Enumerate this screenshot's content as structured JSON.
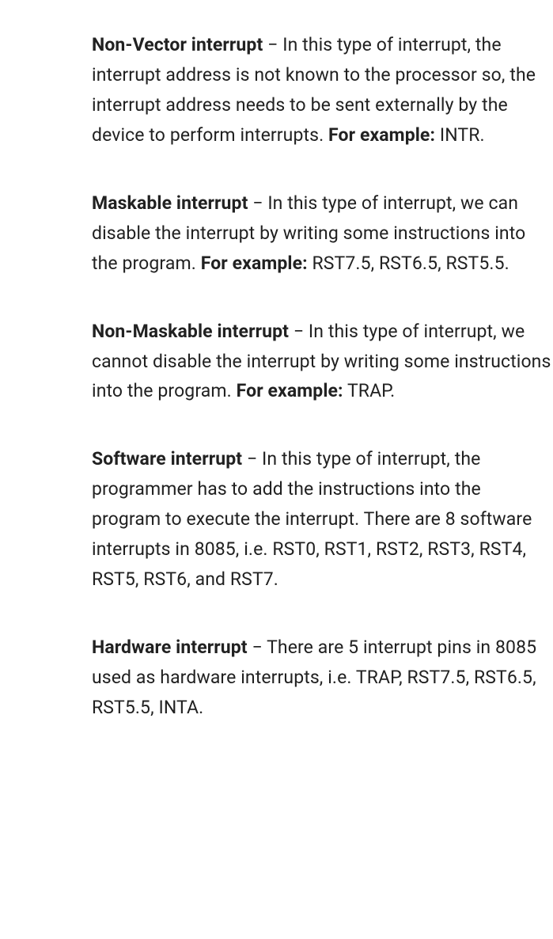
{
  "entries": [
    {
      "term": "Non-Vector interrupt",
      "dash": " − ",
      "description": "In this type of interrupt, the interrupt address is not known to the processor so, the interrupt address needs to be sent externally by the device to perform interrupts. ",
      "example_label": "For example:",
      "example_text": " INTR."
    },
    {
      "term": "Maskable interrupt",
      "dash": " − ",
      "description": "In this type of interrupt, we can disable the interrupt by writing some instructions into the program. ",
      "example_label": "For example:",
      "example_text": " RST7.5, RST6.5, RST5.5."
    },
    {
      "term": "Non-Maskable interrupt",
      "dash": " − ",
      "description": "In this type of interrupt, we cannot disable the interrupt by writing some instructions into the program. ",
      "example_label": "For example:",
      "example_text": " TRAP."
    },
    {
      "term": "Software interrupt",
      "dash": " − ",
      "description": "In this type of interrupt, the programmer has to add the instructions into the program to execute the interrupt. There are 8 software interrupts in 8085, i.e. RST0, RST1, RST2, RST3, RST4, RST5, RST6, and RST7.",
      "example_label": "",
      "example_text": ""
    },
    {
      "term": "Hardware interrupt",
      "dash": " − ",
      "description": "There are 5 interrupt pins in 8085 used as hardware interrupts, i.e. TRAP, RST7.5, RST6.5, RST5.5, INTA.",
      "example_label": "",
      "example_text": ""
    }
  ]
}
